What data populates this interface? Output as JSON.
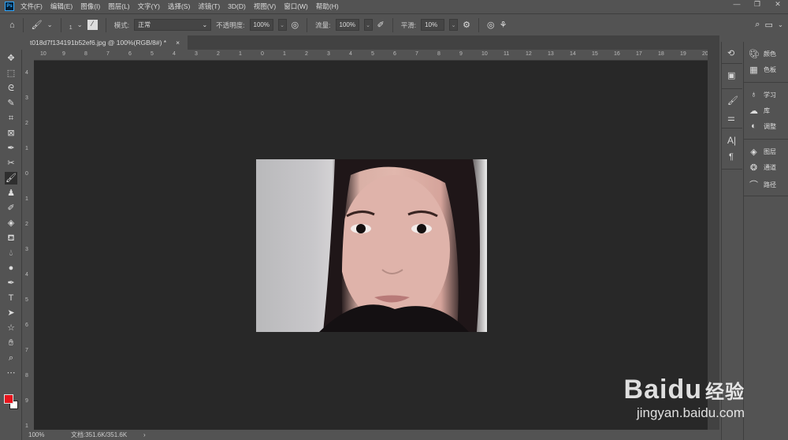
{
  "app": {
    "logo": "Ps"
  },
  "menu": [
    "文件(F)",
    "编辑(E)",
    "图像(I)",
    "图层(L)",
    "文字(Y)",
    "选择(S)",
    "滤镜(T)",
    "3D(D)",
    "视图(V)",
    "窗口(W)",
    "帮助(H)"
  ],
  "window_controls": [
    "—",
    "❐",
    "✕"
  ],
  "options": {
    "brush_size": "1",
    "mode_label": "模式:",
    "mode_value": "正常",
    "opacity_label": "不透明度:",
    "opacity_value": "100%",
    "flow_label": "流量:",
    "flow_value": "100%",
    "smooth_label": "平滑:",
    "smooth_value": "10%"
  },
  "document": {
    "tab_title": "t018d7f134191b52ef6.jpg @ 100%(RGB/8#) *",
    "close": "×"
  },
  "ruler": {
    "h": [
      "10",
      "9",
      "8",
      "7",
      "6",
      "5",
      "4",
      "3",
      "2",
      "1",
      "0",
      "1",
      "2",
      "3",
      "4",
      "5",
      "6",
      "7",
      "8",
      "9",
      "10",
      "11",
      "12",
      "13",
      "14",
      "15",
      "16",
      "17",
      "18",
      "19",
      "20"
    ],
    "v": [
      "4",
      "3",
      "2",
      "1",
      "0",
      "1",
      "2",
      "3",
      "4",
      "5",
      "6",
      "7",
      "8",
      "9",
      "1"
    ]
  },
  "status": {
    "zoom": "100%",
    "doc": "文档:351.6K/351.6K",
    "arrow": "›"
  },
  "panels": [
    {
      "items": [
        {
          "icon": "palette-icon",
          "label": "颜色"
        },
        {
          "icon": "grid-icon",
          "label": "色板"
        }
      ]
    },
    {
      "items": [
        {
          "icon": "lightbulb-icon",
          "label": "学习"
        },
        {
          "icon": "cc-library-icon",
          "label": "库"
        },
        {
          "icon": "adjust-icon",
          "label": "调整"
        }
      ]
    },
    {
      "items": [
        {
          "icon": "layers-icon",
          "label": "图层"
        },
        {
          "icon": "channels-icon",
          "label": "通道"
        },
        {
          "icon": "paths-icon",
          "label": "路径"
        }
      ]
    }
  ],
  "colors": {
    "foreground": "#e8141c",
    "background": "#ffffff"
  },
  "watermark": {
    "brand": "Baidu",
    "suffix": "经验",
    "url": "jingyan.baidu.com"
  }
}
